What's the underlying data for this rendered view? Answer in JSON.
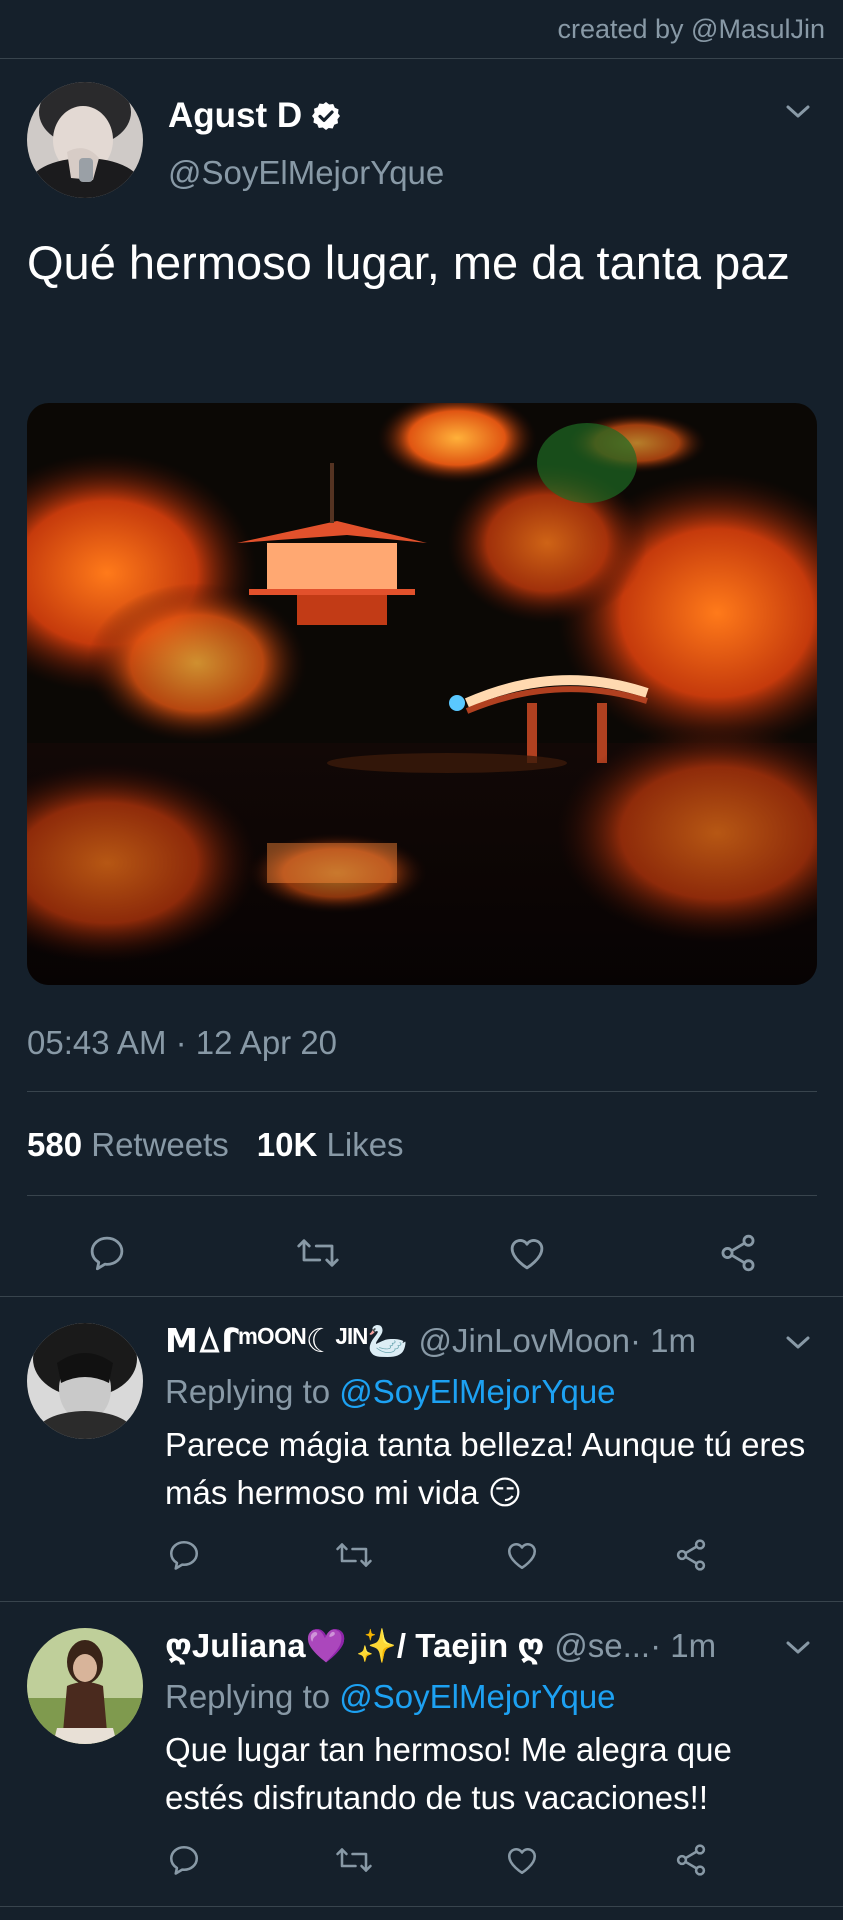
{
  "watermark": "created by @MasulJin",
  "main_tweet": {
    "display_name": "Agust D",
    "handle": "@SoyElMejorYque",
    "text": "Qué hermoso lugar, me da tanta paz",
    "timestamp": "05:43 AM · 12 Apr 20",
    "retweets_count": "580",
    "retweets_label": "Retweets",
    "likes_count": "10K",
    "likes_label": "Likes"
  },
  "replies": [
    {
      "display_name": "ꓟꕔꓩᵐᴼᴼᴺ☾ᴶᴵᴺ🦢",
      "handle": "@JinLovMoon",
      "time": " · 1m",
      "replying_prefix": "Replying to ",
      "replying_to": "@SoyElMejorYque",
      "text": "Parece mágia tanta belleza! Aunque tú eres más hermoso mi vida 😏"
    },
    {
      "display_name": "ღJuliana💜 ✨/ Taejin ღ",
      "handle": "@se...",
      "time": " · 1m",
      "replying_prefix": "Replying to ",
      "replying_to": "@SoyElMejorYque",
      "text": "Que lugar tan hermoso! Me alegra que estés disfrutando de tus vacaciones!!"
    }
  ],
  "icons": [
    "reply-icon",
    "retweet-icon",
    "like-icon",
    "share-icon",
    "verified-badge-icon",
    "chevron-down-icon"
  ],
  "colors": {
    "background": "#15202b",
    "secondary_text": "#8899a6",
    "link": "#1da1f2",
    "divider": "#38444d"
  }
}
